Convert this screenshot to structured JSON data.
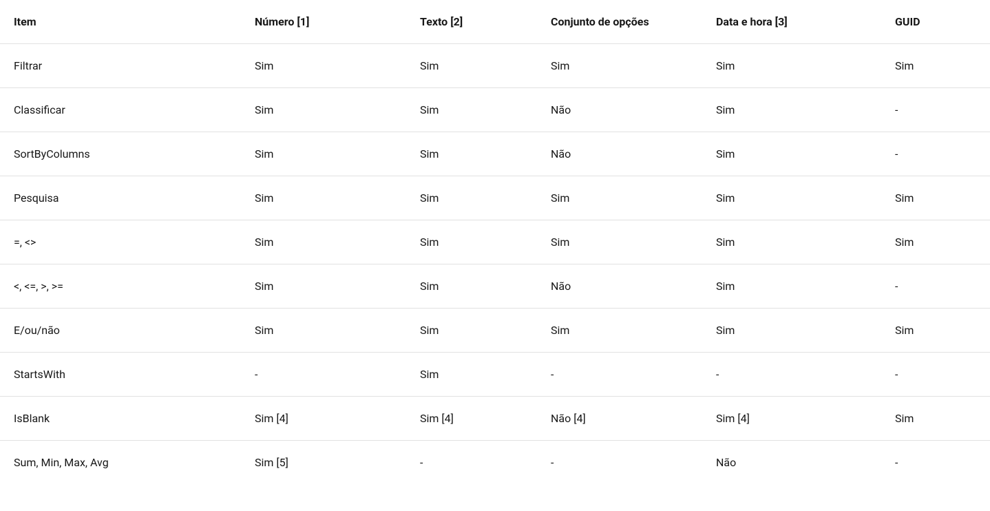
{
  "table": {
    "headers": [
      "Item",
      "Número [1]",
      "Texto [2]",
      "Conjunto de opções",
      "Data e hora [3]",
      "GUID"
    ],
    "rows": [
      [
        "Filtrar",
        "Sim",
        "Sim",
        "Sim",
        "Sim",
        "Sim"
      ],
      [
        "Classificar",
        "Sim",
        "Sim",
        "Não",
        "Sim",
        "-"
      ],
      [
        "SortByColumns",
        "Sim",
        "Sim",
        "Não",
        "Sim",
        "-"
      ],
      [
        "Pesquisa",
        "Sim",
        "Sim",
        "Sim",
        "Sim",
        "Sim"
      ],
      [
        "=, <>",
        "Sim",
        "Sim",
        "Sim",
        "Sim",
        "Sim"
      ],
      [
        "<, <=, >, >=",
        "Sim",
        "Sim",
        "Não",
        "Sim",
        "-"
      ],
      [
        "E/ou/não",
        "Sim",
        "Sim",
        "Sim",
        "Sim",
        "Sim"
      ],
      [
        "StartsWith",
        "-",
        "Sim",
        "-",
        "-",
        "-"
      ],
      [
        "IsBlank",
        "Sim [4]",
        "Sim [4]",
        "Não [4]",
        "Sim [4]",
        "Sim"
      ],
      [
        "Sum, Min, Max, Avg",
        "Sim [5]",
        "-",
        "-",
        "Não",
        "-"
      ]
    ]
  }
}
